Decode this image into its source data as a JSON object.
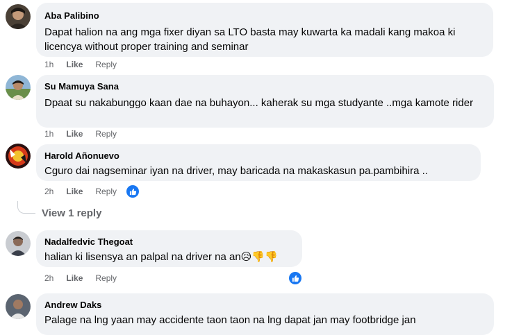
{
  "comments": [
    {
      "author": "Aba Palibino",
      "text": "Dapat halion na ang mga fixer diyan sa LTO basta may kuwarta ka madali kang makoa ki licencya without proper training and seminar",
      "time": "1h",
      "like": "Like",
      "reply": "Reply"
    },
    {
      "author": "Su Mamuya Sana",
      "text": "Dpaat su nakabunggo kaan dae na buhayon... kaherak su mga studyante ..mga kamote rider",
      "time": "1h",
      "like": "Like",
      "reply": "Reply"
    },
    {
      "author": "Harold Añonuevo",
      "text": "Cguro dai nagseminar iyan na driver, may baricada na makaskasun pa.pambihira ..",
      "time": "2h",
      "like": "Like",
      "reply": "Reply",
      "view_replies": "View 1 reply"
    },
    {
      "author": "Nadalfedvic Thegoat",
      "text": "halian ki lisensya an palpal na driver na an😥👎👎",
      "time": "2h",
      "like": "Like",
      "reply": "Reply"
    },
    {
      "author": "Andrew Daks",
      "text": "Palage na lng yaan may accidente taon taon na lng dapat jan may footbridge jan"
    }
  ],
  "colors": {
    "bubble": "#f0f2f5",
    "meta": "#65676b",
    "like_badge": "#1877f2"
  },
  "icons": {
    "reaction": "thumbs-up-icon"
  }
}
